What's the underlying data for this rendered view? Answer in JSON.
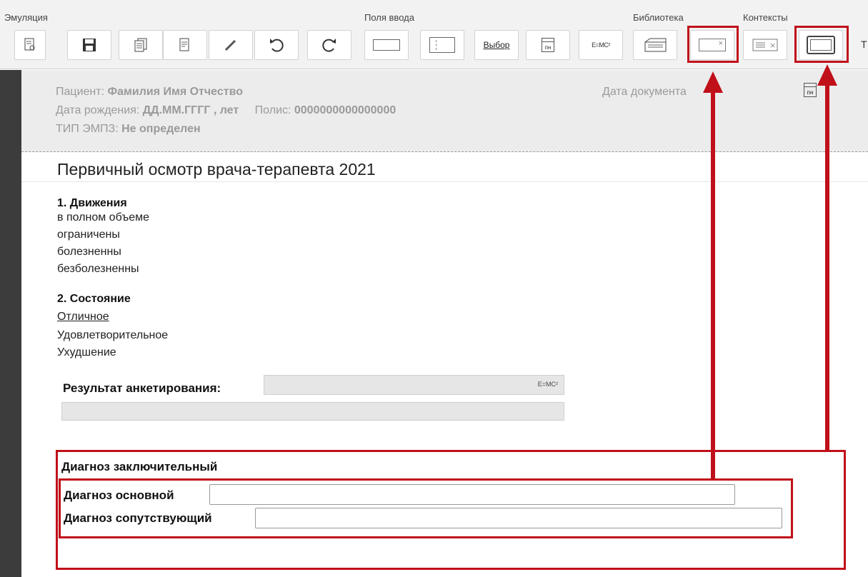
{
  "toolbar": {
    "groups": {
      "emulation": "Эмуляция",
      "input_fields": "Поля ввода",
      "library": "Библиотека",
      "contexts": "Контексты"
    },
    "buttons": {
      "choice_label": "Выбор",
      "formula_label": "E=MC²",
      "calendar_label": "пн",
      "partial_label": "Т"
    }
  },
  "header": {
    "patient_label": "Пациент:",
    "patient_value": "Фамилия Имя Отчество",
    "birth_label": "Дата рождения:",
    "birth_value": "ДД.ММ.ГГГГ , лет",
    "policy_label": "Полис:",
    "policy_value": "0000000000000000",
    "type_label": "ТИП ЭМПЗ:",
    "type_value": "Не определен",
    "doc_date_label": "Дата документа",
    "calendar_label": "пн"
  },
  "document": {
    "title": "Первичный осмотр врача-терапевта 2021",
    "sections": [
      {
        "heading": "1. Движения",
        "options": [
          "в полном объеме",
          "ограничены",
          "болезненны",
          "безболезненны"
        ]
      },
      {
        "heading": "2. Состояние",
        "options": [
          "Отличное",
          "Удовлетворительное",
          "Ухудшение"
        ]
      }
    ],
    "result_label": "Результат анкетирования:",
    "result_formula": "E=MC²",
    "diagnosis": {
      "title": "Диагноз заключительный",
      "main_label": "Диагноз основной",
      "main_value": "",
      "secondary_label": "Диагноз сопутствующий",
      "secondary_value": ""
    }
  },
  "colors": {
    "highlight": "#c0101a",
    "toolbar_bg": "#f2f2f2",
    "header_bg": "#ececec",
    "sidebar_bg": "#3c3c3c"
  }
}
